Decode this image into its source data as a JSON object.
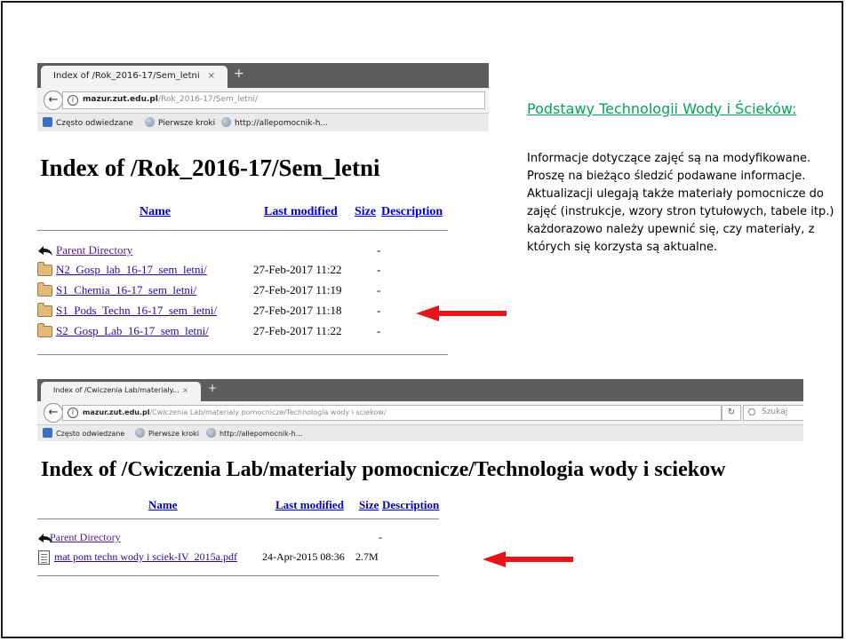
{
  "window1": {
    "tab_title": "Index of /Rok_2016-17/Sem_letni",
    "tab_close": "×",
    "new_tab": "+",
    "url_domain": "mazur.zut.edu.pl",
    "url_path": "/Rok_2016-17/Sem_letni/",
    "bookmarks": [
      "Często odwiedzane",
      "Pierwsze kroki",
      "http://allepomocnik-h..."
    ],
    "heading": "Index of /Rok_2016-17/Sem_letni",
    "columns": {
      "name": "Name",
      "modified": "Last modified",
      "size": "Size",
      "description": "Description"
    },
    "parent": {
      "name": "Parent Directory",
      "size": "-"
    },
    "rows": [
      {
        "name": "N2_Gosp_lab_16-17_sem_letni/",
        "modified": "27-Feb-2017 11:22",
        "size": "-"
      },
      {
        "name": "S1_Chemia_16-17_sem_letni/",
        "modified": "27-Feb-2017 11:19",
        "size": "-"
      },
      {
        "name": "S1_Pods_Techn_16-17_sem_letni/",
        "modified": "27-Feb-2017 11:18",
        "size": "-"
      },
      {
        "name": "S2_Gosp_Lab_16-17_sem_letni/",
        "modified": "27-Feb-2017 11:22",
        "size": "-"
      }
    ]
  },
  "window2": {
    "tab_title": "Index of /Cwiczenia Lab/materialy...",
    "tab_close": "×",
    "new_tab": "+",
    "url_domain": "mazur.zut.edu.pl",
    "url_path": "/Cwiczenia Lab/materialy pomocnicze/Technologia wody i sciekow/",
    "search_placeholder": "Szukaj",
    "bookmarks": [
      "Często odwiedzane",
      "Pierwsze kroki",
      "http://allepomocnik-h..."
    ],
    "heading": "Index of /Cwiczenia Lab/materialy pomocnicze/Technologia wody i sciekow",
    "columns": {
      "name": "Name",
      "modified": "Last modified",
      "size": "Size",
      "description": "Description"
    },
    "parent": {
      "name": "Parent Directory",
      "size": "-"
    },
    "rows": [
      {
        "name": "mat pom techn wody i sciek-IV_2015a.pdf",
        "modified": "24-Apr-2015 08:36",
        "size": "2.7M"
      }
    ]
  },
  "side_panel": {
    "title": "Podstawy Technologii Wody i Ścieków:",
    "text": "Informacje dotyczące zajęć są na modyfikowane. Proszę na bieżąco śledzić podawane informacje. Aktualizacji ulegają także materiały pomocnicze do zajęć (instrukcje, wzory stron tytułowych, tabele itp.) każdorazowo należy upewnić się, czy materiały, z których się korzysta są aktualne."
  },
  "colors": {
    "arrow": "#e8141c",
    "title_green": "#00a651",
    "link_blue": "#1a0dab"
  }
}
